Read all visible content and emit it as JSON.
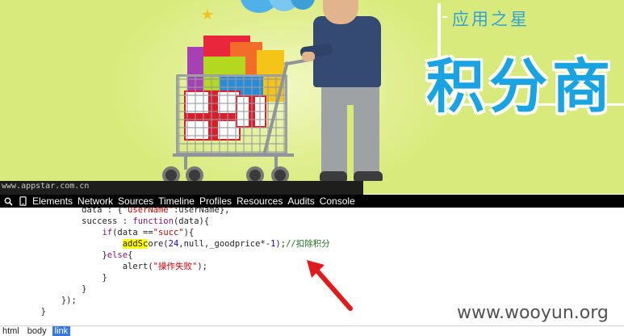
{
  "banner": {
    "subtitle": "应用之星",
    "title": "积分商",
    "site_url": "www.appstar.com.cn",
    "colors": {
      "background": "#d8ea7b",
      "title": "#1aa3e2"
    }
  },
  "devtools": {
    "icons": [
      "search-icon",
      "device-mode-icon"
    ],
    "tabs": [
      "Elements",
      "Network",
      "Sources",
      "Timeline",
      "Profiles",
      "Resources",
      "Audits",
      "Console"
    ]
  },
  "code": {
    "line1": {
      "indent": "                ",
      "text_a": "data : {",
      "str": "\"userName\"",
      "text_b": ":userName},",
      "note": "partially clipped at top"
    },
    "line2": {
      "indent": "                ",
      "prop": "success : ",
      "kw": "function",
      "rest": "(data){"
    },
    "line3": {
      "indent": "                    ",
      "kw": "if",
      "rest_a": "(data ==",
      "str": "\"succ\"",
      "rest_b": "){"
    },
    "line4": {
      "indent": "                        ",
      "hl": "addSc",
      "rest_a": "ore(",
      "num1": "24",
      "rest_b": ",null,_goodprice*-",
      "num2": "1",
      "rest_c": ");",
      "comment": "//扣除积分"
    },
    "line5": {
      "indent": "                    ",
      "text": "}",
      "kw": "else",
      "rest": "{"
    },
    "line6": {
      "indent": "                        ",
      "fn": "alert(",
      "str": "\"操作失败\"",
      "rest": ");"
    },
    "line7": {
      "indent": "                    ",
      "text": "}"
    },
    "line8": {
      "indent": "                ",
      "text": "}"
    },
    "line9": {
      "indent": "            ",
      "text": "});"
    },
    "line10": {
      "indent": "        ",
      "text": "}"
    }
  },
  "watermark": "www.wooyun.org",
  "breadcrumbs": [
    {
      "label": "html",
      "selected": false
    },
    {
      "label": "body",
      "selected": false
    },
    {
      "label": "link",
      "selected": true
    }
  ]
}
